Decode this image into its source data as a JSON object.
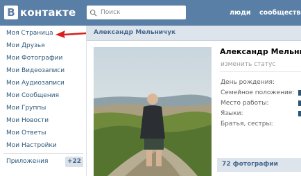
{
  "topbar": {
    "logo_glyph": "В",
    "logo_text": "контакте",
    "search_placeholder": "Поиск",
    "nav": [
      "люди",
      "сообщества"
    ]
  },
  "sidebar": {
    "items": [
      "Моя Страница",
      "Мои Друзья",
      "Мои Фотографии",
      "Мои Видеозаписи",
      "Мои Аудиозаписи",
      "Мои Сообщения",
      "Мои Группы",
      "Мои Новости",
      "Мои Ответы",
      "Мои Настройки"
    ],
    "apps_label": "Приложения",
    "apps_badge": "+22"
  },
  "profile": {
    "header_name": "Александр Мельничук",
    "name": "Александр Мельничу",
    "status_placeholder": "изменить статус",
    "info_labels": [
      "День рождения:",
      "Семейное положение:",
      "Место работы:",
      "Языки:",
      "Братья, сестры:"
    ],
    "photos_label": "72 фотографии"
  },
  "colors": {
    "topbar": "#5a7fa6",
    "link": "#2b587a",
    "header_bg": "#dde4eb",
    "arrow": "#d81e1e"
  },
  "icons": [
    "search-icon",
    "red-arrow-icon"
  ]
}
